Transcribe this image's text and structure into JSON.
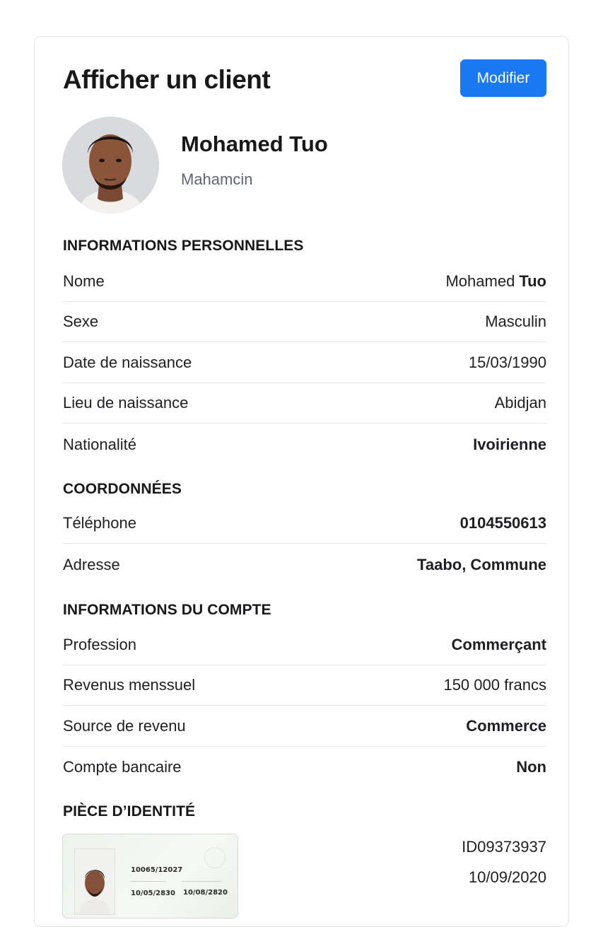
{
  "page": {
    "title": "Afficher un client",
    "edit_button": "Modifier"
  },
  "profile": {
    "full_name": "Mohamed Tuo",
    "username": "Mahamcin"
  },
  "sections": {
    "personal": {
      "title": "INFORMATIONS PERSONNELLES",
      "rows": [
        {
          "label": "Nome",
          "value": "Mohamed",
          "value_bold": "Tuo"
        },
        {
          "label": "Sexe",
          "value": "Masculin"
        },
        {
          "label": "Date de naissance",
          "value": "15/03/1990"
        },
        {
          "label": "Lieu de naissance",
          "value": "Abidjan"
        },
        {
          "label": "Nationalité",
          "value": "Ivoirienne"
        }
      ]
    },
    "contact": {
      "title": "COORDONNÉES",
      "rows": [
        {
          "label": "Téléphone",
          "value": "0104550613"
        },
        {
          "label": "Adresse",
          "value": "Taabo, Commune"
        }
      ]
    },
    "account": {
      "title": "INFORMATIONS DU COMPTE",
      "rows": [
        {
          "label": "Profession",
          "value": "Commerçant"
        },
        {
          "label": "Revenus menssuel",
          "value": "150 000 francs"
        },
        {
          "label": "Source de revenu",
          "value": "Commerce"
        },
        {
          "label": "Compte bancaire",
          "value": "Non"
        }
      ]
    },
    "identity": {
      "title": "PIÈCE D’IDENTITÉ",
      "id_number": "ID09373937",
      "id_date": "10/09/2020",
      "card_text": {
        "number": "10065/12027",
        "date_left": "10/05/2830",
        "date_right": "10/08/2820"
      }
    }
  },
  "colors": {
    "primary_button": "#1a78f2",
    "username_text": "#5d6675",
    "border": "#e3e5e8"
  }
}
